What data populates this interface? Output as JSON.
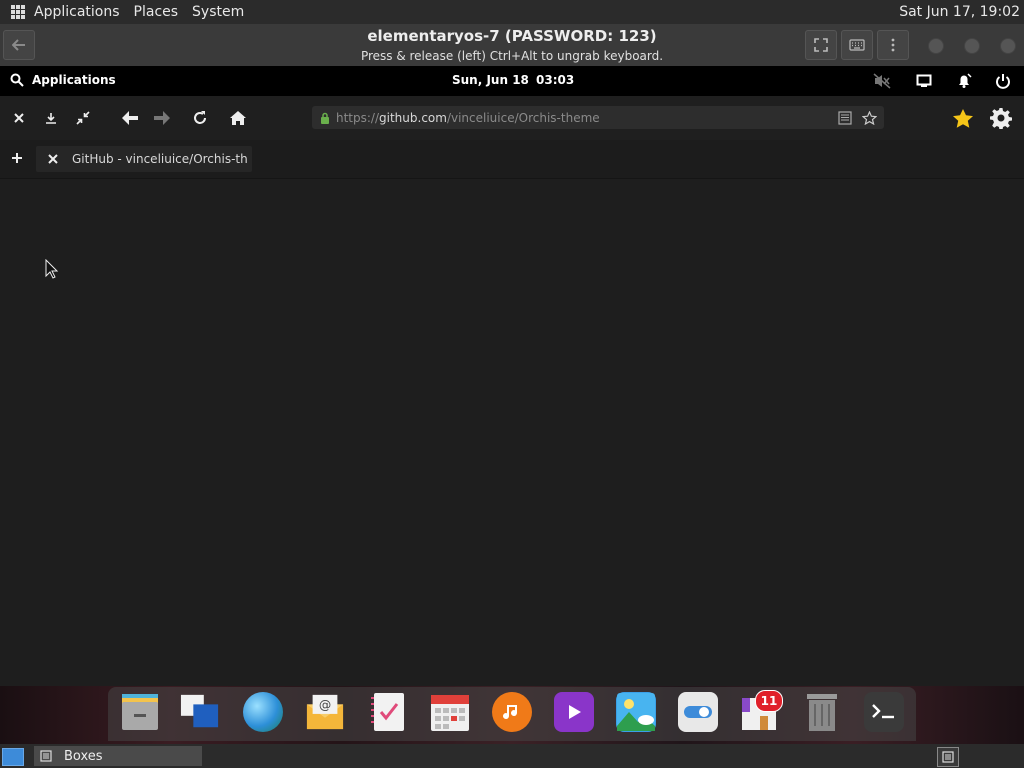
{
  "host_panel": {
    "menus": [
      "Applications",
      "Places",
      "System"
    ],
    "clock": "Sat Jun 17, 19:02"
  },
  "boxes": {
    "title": "elementaryos-7 (PASSWORD: 123)",
    "subtitle": "Press & release (left) Ctrl+Alt to ungrab keyboard."
  },
  "guest_panel": {
    "applications_label": "Applications",
    "date": "Sun, Jun 18",
    "time": "03:03"
  },
  "browser": {
    "url_prefix": "https://",
    "url_host": "github.com",
    "url_path": "/vinceliuice/Orchis-theme",
    "tab_title": "GitHub - vinceliuice/Orchis-th"
  },
  "dock": {
    "badge_count": "11",
    "items": [
      "files-icon",
      "multitasking-icon",
      "web-browser-icon",
      "mail-icon",
      "tasks-icon",
      "calendar-icon",
      "music-icon",
      "videos-icon",
      "photos-icon",
      "settings-icon",
      "appcenter-icon",
      "trash-icon",
      "terminal-icon"
    ]
  },
  "taskbar": {
    "item": "Boxes"
  },
  "colors": {
    "accent_blue": "#3d8bd9",
    "badge_red": "#e0202a",
    "star_yellow": "#f5c518"
  }
}
